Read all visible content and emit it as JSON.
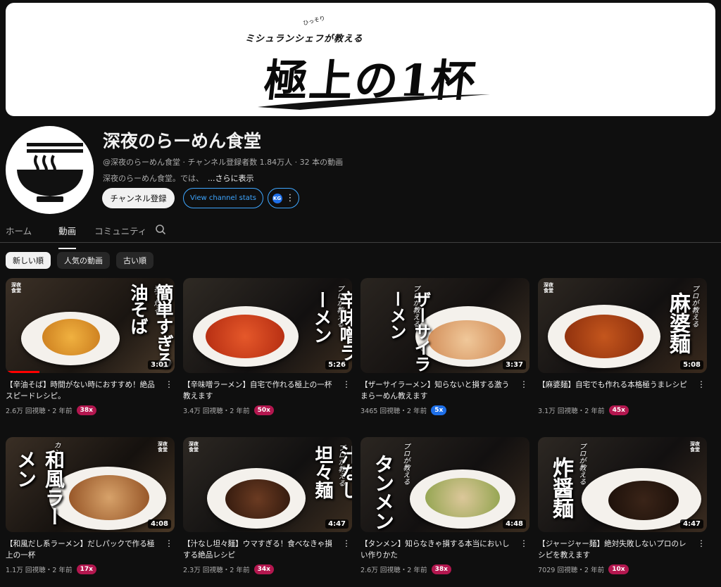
{
  "banner": {
    "tagline": "ミシュランシェフが教える",
    "tagline_ruby": "ひっそり",
    "title": "極上の1杯"
  },
  "channel": {
    "name": "深夜のらーめん食堂",
    "meta": "@深夜のらーめん食堂 · チャンネル登録者数 1.84万人 · 32 本の動画",
    "description": "深夜のらーめん食堂。では、",
    "more_label": "...さらに表示",
    "subscribe_label": "チャンネル登録",
    "stats_label": "View channel stats",
    "ext_logo": "KG"
  },
  "tabs": [
    {
      "label": "ホーム"
    },
    {
      "label": "動画"
    },
    {
      "label": "コミュニティ"
    }
  ],
  "chips": [
    {
      "label": "新しい順"
    },
    {
      "label": "人気の動画"
    },
    {
      "label": "古い順"
    }
  ],
  "videos": [
    {
      "title": "【辛油そば】時間がない時におすすめ！絶品スピードレシピ。",
      "views": "2.6万 回視聴・2 年前",
      "badge": "38x",
      "badge_color": "#b3174f",
      "duration": "3:01",
      "thumb_text": "簡単すぎる油そば",
      "tag": "独で炒る"
    },
    {
      "title": "【辛味噌ラーメン】自宅で作れる極上の一杯教えます",
      "views": "3.4万 回視聴・2 年前",
      "badge": "50x",
      "badge_color": "#b3174f",
      "duration": "5:26",
      "thumb_text": "辛味噌ラーメン",
      "tag": "プロが教える"
    },
    {
      "title": "【ザーサイラーメン】知らないと損する激うまらーめん教えます",
      "views": "3465 回視聴・2 年前",
      "badge": "5x",
      "badge_color": "#1e6fe8",
      "duration": "3:37",
      "thumb_text": "ザーサイラーメン",
      "tag": "プロが教える"
    },
    {
      "title": "【麻婆麺】自宅でも作れる本格極うまレシピ",
      "views": "3.1万 回視聴・2 年前",
      "badge": "45x",
      "badge_color": "#b3174f",
      "duration": "5:08",
      "thumb_text": "麻婆麺",
      "tag": "プロが教える"
    },
    {
      "title": "【和風だし系ラーメン】だしパックで作る極上の一杯",
      "views": "1.1万 回視聴・2 年前",
      "badge": "17x",
      "badge_color": "#b3174f",
      "duration": "4:08",
      "thumb_text": "和風ラーメン",
      "tag": "カンタン"
    },
    {
      "title": "【汁なし坦々麺】ウマすぎる！食べなきゃ損する絶品レシピ",
      "views": "2.3万 回視聴・2 年前",
      "badge": "34x",
      "badge_color": "#b3174f",
      "duration": "4:47",
      "thumb_text": "汁なし坦々麺",
      "tag": "プロが教える"
    },
    {
      "title": "【タンメン】知らなきゃ損する本当においしい作りかた",
      "views": "2.6万 回視聴・2 年前",
      "badge": "38x",
      "badge_color": "#b3174f",
      "duration": "4:48",
      "thumb_text": "タンメン",
      "tag": "プロが教える"
    },
    {
      "title": "【ジャージャー麺】絶対失敗しないプロのレシピを教えます",
      "views": "7029 回視聴・2 年前",
      "badge": "10x",
      "badge_color": "#b3174f",
      "duration": "4:47",
      "thumb_text": "炸醤麺",
      "tag": "プロが教える"
    }
  ]
}
